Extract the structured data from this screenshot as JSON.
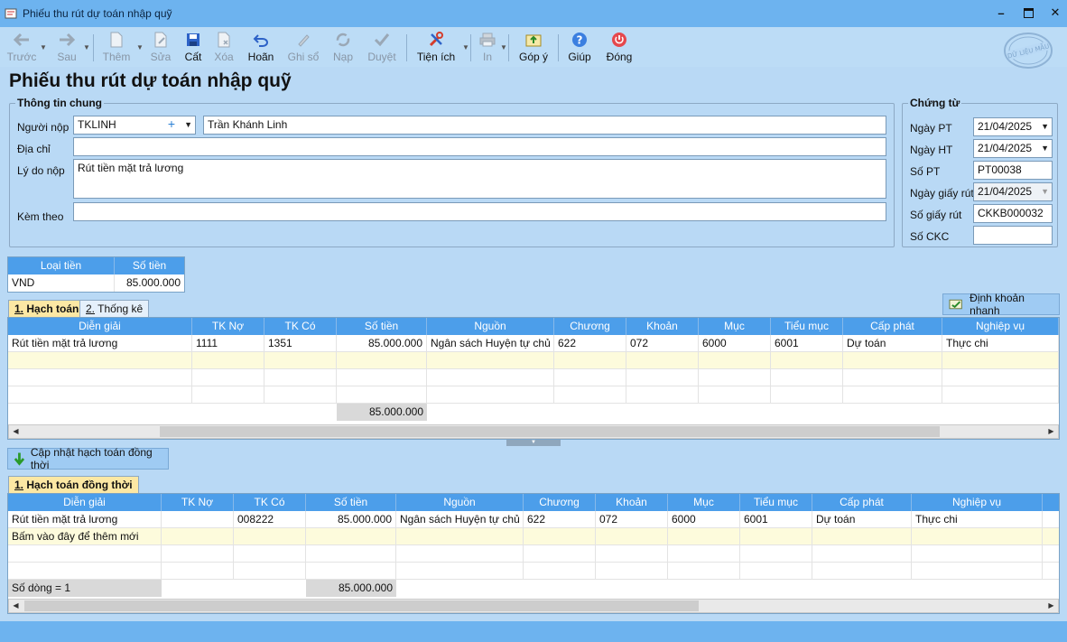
{
  "window": {
    "title": "Phiếu thu rút dự toán nhập quỹ"
  },
  "toolbar": {
    "prev": "Trước",
    "next": "Sau",
    "add": "Thêm",
    "edit": "Sửa",
    "save": "Cất",
    "delete": "Xóa",
    "undo": "Hoãn",
    "post": "Ghi sổ",
    "load": "Nạp",
    "approve": "Duyệt",
    "utility": "Tiện ích",
    "print": "In",
    "feedback": "Góp ý",
    "help": "Giúp",
    "close": "Đóng"
  },
  "page_title": "Phiếu thu rút dự toán nhập quỹ",
  "general": {
    "title": "Thông tin chung",
    "payer_label": "Người nộp",
    "payer_code": "TKLINH",
    "payer_name": "Trần Khánh Linh",
    "address_label": "Địa chỉ",
    "address": "",
    "reason_label": "Lý do nộp",
    "reason": "Rút tiền mặt trả lương",
    "attach_label": "Kèm theo",
    "attach": ""
  },
  "voucher": {
    "title": "Chứng từ",
    "rows": [
      {
        "label": "Ngày PT",
        "value": "21/04/2025",
        "dropdown": true,
        "disabled": false
      },
      {
        "label": "Ngày HT",
        "value": "21/04/2025",
        "dropdown": true,
        "disabled": false
      },
      {
        "label": "Số PT",
        "value": "PT00038",
        "dropdown": false,
        "disabled": false
      },
      {
        "label": "Ngày giấy rút",
        "value": "21/04/2025",
        "dropdown": true,
        "disabled": true
      },
      {
        "label": "Số giấy rút",
        "value": "CKKB000032",
        "dropdown": false,
        "disabled": false
      },
      {
        "label": "Số CKC",
        "value": "",
        "dropdown": false,
        "disabled": false
      }
    ]
  },
  "currency": {
    "headers": [
      "Loại tiền",
      "Số tiền"
    ],
    "row": [
      "VND",
      "85.000.000"
    ]
  },
  "tabs": {
    "accounting": "Hạch toán",
    "accounting_num": "1.",
    "stats": "Thống kê",
    "stats_num": "2."
  },
  "quick_entry": "Định khoản nhanh",
  "grid1": {
    "headers": [
      "Diễn giải",
      "TK Nợ",
      "TK Có",
      "Số tiền",
      "Nguồn",
      "Chương",
      "Khoản",
      "Mục",
      "Tiểu mục",
      "Cấp phát",
      "Nghiệp vụ"
    ],
    "rows": [
      [
        "Rút tiền mặt trả lương",
        "1111",
        "1351",
        "85.000.000",
        "Ngân sách Huyện tự chủ",
        "622",
        "072",
        "6000",
        "6001",
        "Dự toán",
        "Thực chi"
      ]
    ],
    "total": "85.000.000"
  },
  "update_btn": "Cập nhật hạch toán đồng thời",
  "tab2": {
    "num": "1.",
    "label": "Hạch toán đồng thời"
  },
  "grid2": {
    "headers": [
      "Diễn giải",
      "TK Nợ",
      "TK Có",
      "Số tiền",
      "Nguồn",
      "Chương",
      "Khoản",
      "Mục",
      "Tiểu mục",
      "Cấp phát",
      "Nghiệp vụ"
    ],
    "rows": [
      [
        "Rút tiền mặt trả lương",
        "",
        "008222",
        "85.000.000",
        "Ngân sách Huyện tự chủ",
        "622",
        "072",
        "6000",
        "6001",
        "Dự toán",
        "Thực chi"
      ]
    ],
    "new_row_hint": "Bấm vào đây để thêm mới",
    "row_count": "Số dòng = 1",
    "total": "85.000.000"
  },
  "colors": {
    "header_blue": "#4c9eea",
    "title_bar": "#6db3ef",
    "background": "#b9d9f5",
    "active_tab": "#fce8a4"
  }
}
